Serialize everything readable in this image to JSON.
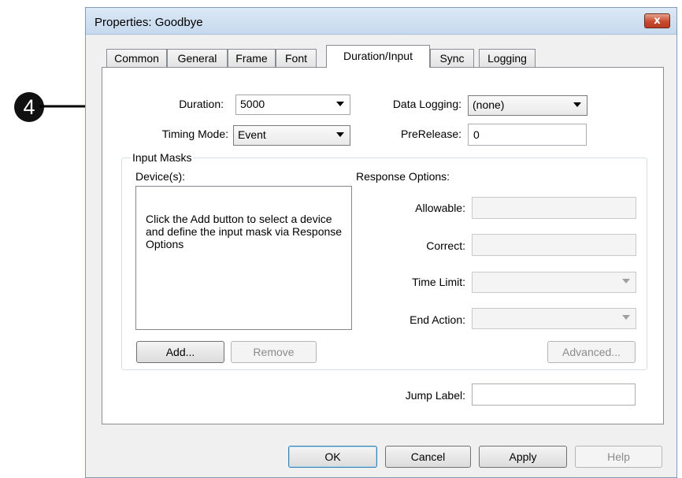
{
  "callout": {
    "number": "4"
  },
  "window": {
    "title": "Properties: Goodbye",
    "close_symbol": "x"
  },
  "tabs": [
    {
      "label": "Common",
      "active": false
    },
    {
      "label": "General",
      "active": false
    },
    {
      "label": "Frame",
      "active": false
    },
    {
      "label": "Font",
      "active": false
    },
    {
      "label": "Duration/Input",
      "active": true
    },
    {
      "label": "Sync",
      "active": false
    },
    {
      "label": "Logging",
      "active": false
    }
  ],
  "duration": {
    "label": "Duration:",
    "value": "5000"
  },
  "data_logging": {
    "label": "Data Logging:",
    "value": "(none)"
  },
  "timing_mode": {
    "label": "Timing Mode:",
    "value": "Event"
  },
  "prerelease": {
    "label": "PreRelease:",
    "value": "0"
  },
  "input_masks": {
    "title": "Input Masks",
    "devices_label": "Device(s):",
    "devices_placeholder": "Click the Add button to select a device and define the input mask via Response Options",
    "add_button": "Add...",
    "remove_button": "Remove"
  },
  "response_options": {
    "title": "Response Options:",
    "allowable_label": "Allowable:",
    "allowable_value": "",
    "correct_label": "Correct:",
    "correct_value": "",
    "time_limit_label": "Time Limit:",
    "time_limit_value": "",
    "end_action_label": "End Action:",
    "end_action_value": "",
    "advanced_button": "Advanced..."
  },
  "jump_label": {
    "label": "Jump Label:",
    "value": ""
  },
  "footer": {
    "ok": "OK",
    "cancel": "Cancel",
    "apply": "Apply",
    "help": "Help"
  },
  "colors": {
    "title_bar": "#c5d9ee",
    "close_button": "#c94a2f",
    "panel": "#ffffff",
    "window_bg": "#f0f0f0"
  }
}
